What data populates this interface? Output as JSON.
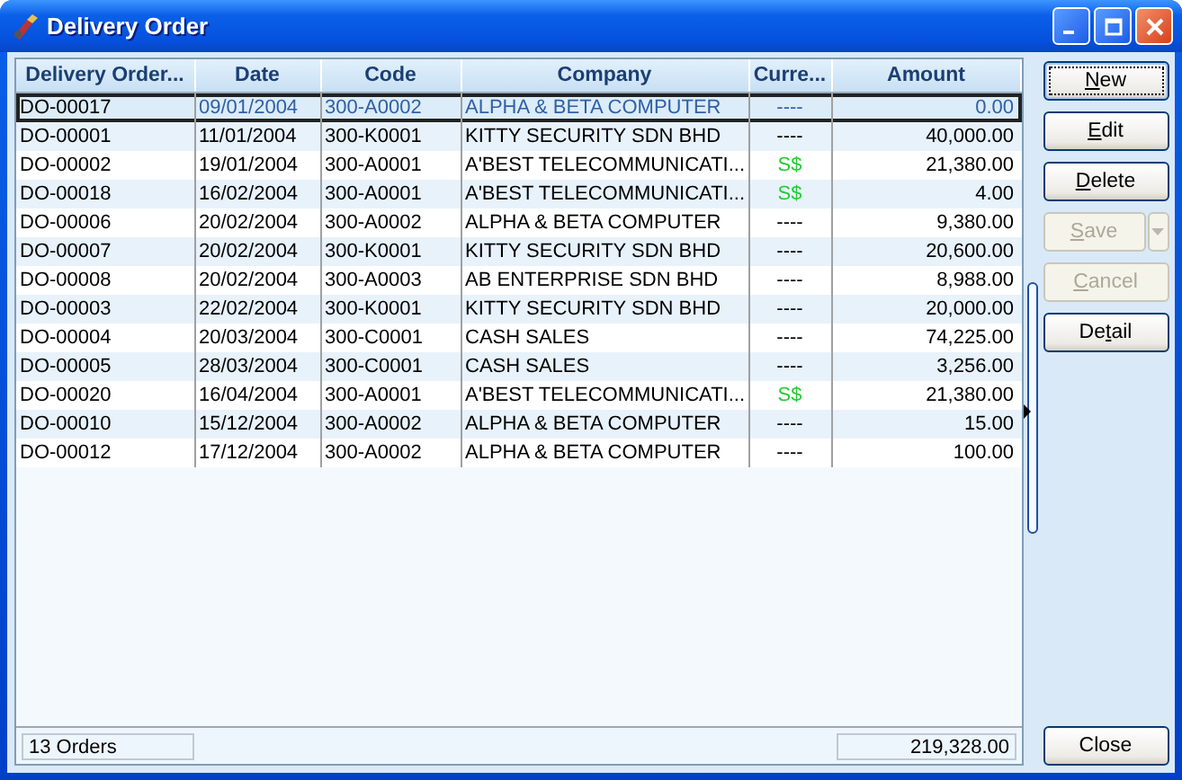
{
  "window": {
    "title": "Delivery Order"
  },
  "table": {
    "columns": [
      "Delivery Order...",
      "Date",
      "Code",
      "Company",
      "Curre...",
      "Amount"
    ],
    "rows": [
      {
        "cells": [
          "DO-00017",
          "09/01/2004",
          "300-A0002",
          "ALPHA & BETA COMPUTER",
          "----",
          "0.00"
        ],
        "selected": true
      },
      {
        "cells": [
          "DO-00001",
          "11/01/2004",
          "300-K0001",
          "KITTY SECURITY SDN BHD",
          "----",
          "40,000.00"
        ],
        "selected": false
      },
      {
        "cells": [
          "DO-00002",
          "19/01/2004",
          "300-A0001",
          "A'BEST TELECOMMUNICATI...",
          "S$",
          "21,380.00"
        ],
        "selected": false,
        "color": "#22cc33"
      },
      {
        "cells": [
          "DO-00018",
          "16/02/2004",
          "300-A0001",
          "A'BEST TELECOMMUNICATI...",
          "S$",
          "4.00"
        ],
        "selected": false,
        "color": "#22cc33"
      },
      {
        "cells": [
          "DO-00006",
          "20/02/2004",
          "300-A0002",
          "ALPHA & BETA COMPUTER",
          "----",
          "9,380.00"
        ],
        "selected": false
      },
      {
        "cells": [
          "DO-00007",
          "20/02/2004",
          "300-K0001",
          "KITTY SECURITY SDN BHD",
          "----",
          "20,600.00"
        ],
        "selected": false
      },
      {
        "cells": [
          "DO-00008",
          "20/02/2004",
          "300-A0003",
          "AB ENTERPRISE SDN BHD",
          "----",
          "8,988.00"
        ],
        "selected": false
      },
      {
        "cells": [
          "DO-00003",
          "22/02/2004",
          "300-K0001",
          "KITTY SECURITY SDN BHD",
          "----",
          "20,000.00"
        ],
        "selected": false
      },
      {
        "cells": [
          "DO-00004",
          "20/03/2004",
          "300-C0001",
          "CASH SALES",
          "----",
          "74,225.00"
        ],
        "selected": false
      },
      {
        "cells": [
          "DO-00005",
          "28/03/2004",
          "300-C0001",
          "CASH SALES",
          "----",
          "3,256.00"
        ],
        "selected": false
      },
      {
        "cells": [
          "DO-00020",
          "16/04/2004",
          "300-A0001",
          "A'BEST TELECOMMUNICATI...",
          "S$",
          "21,380.00"
        ],
        "selected": false,
        "color": "#22cc33"
      },
      {
        "cells": [
          "DO-00010",
          "15/12/2004",
          "300-A0002",
          "ALPHA & BETA COMPUTER",
          "----",
          "15.00"
        ],
        "selected": false
      },
      {
        "cells": [
          "DO-00012",
          "17/12/2004",
          "300-A0002",
          "ALPHA & BETA COMPUTER",
          "----",
          "100.00"
        ],
        "selected": false
      }
    ]
  },
  "status_bar": {
    "count": "13 Orders",
    "total": "219,328.00"
  },
  "buttons": [
    {
      "key": "N",
      "post": "ew",
      "disabled": false,
      "focused": true,
      "kind": "plain"
    },
    {
      "key": "E",
      "post": "dit",
      "disabled": false,
      "focused": false,
      "kind": "plain"
    },
    {
      "key": "D",
      "post": "elete",
      "disabled": false,
      "focused": false,
      "kind": "plain"
    },
    {
      "key": "S",
      "post": "ave",
      "disabled": true,
      "focused": false,
      "kind": "split"
    },
    {
      "key": "C",
      "post": "ancel",
      "disabled": true,
      "focused": false,
      "kind": "plain"
    },
    {
      "pre": "De",
      "key": "t",
      "post": "ail",
      "disabled": false,
      "focused": false,
      "kind": "plain"
    }
  ],
  "close_button": {
    "label": "Close"
  }
}
